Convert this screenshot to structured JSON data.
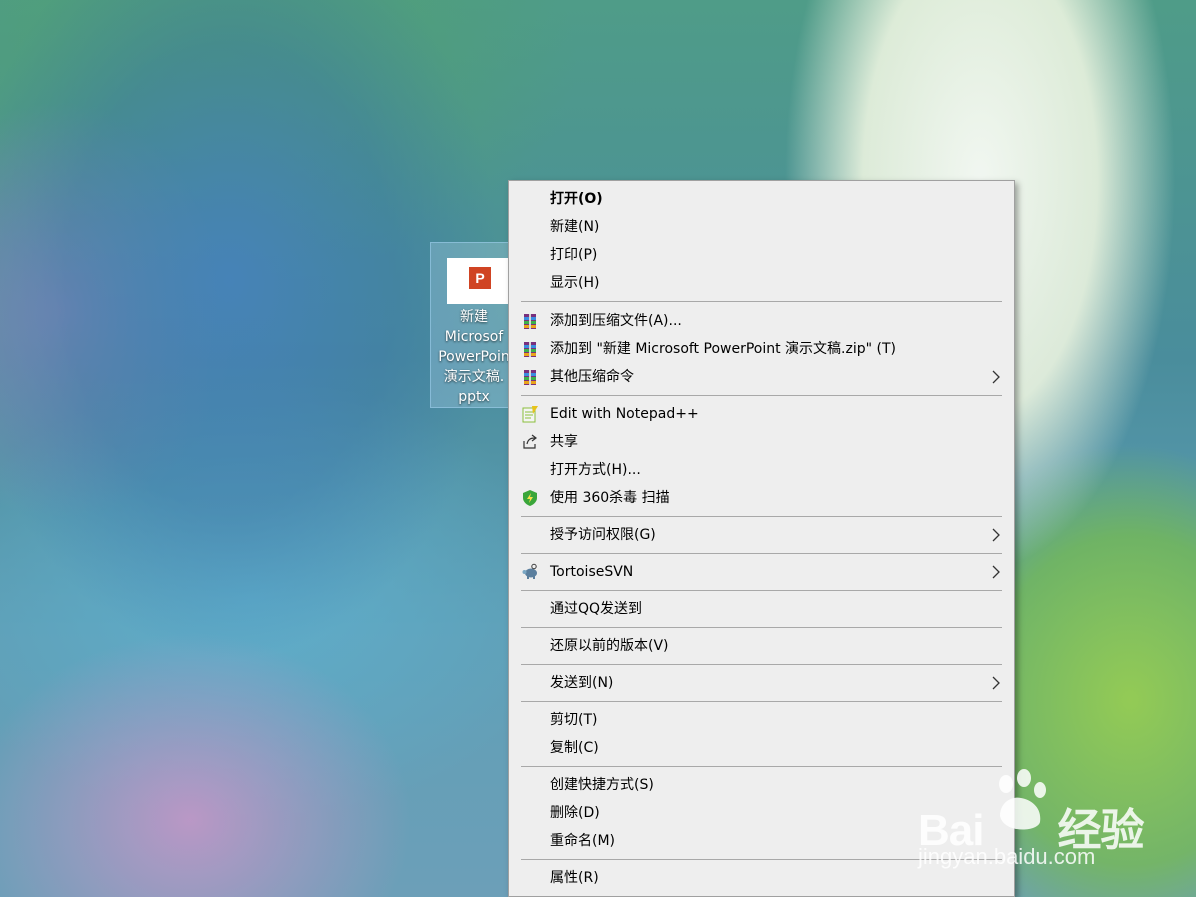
{
  "desktop": {
    "file_icon": {
      "badge": "P",
      "label_lines": [
        "新建",
        "Microsof",
        "PowerPoin",
        "演示文稿.",
        "pptx"
      ]
    }
  },
  "context_menu": {
    "items": {
      "open": "打开(O)",
      "new": "新建(N)",
      "print": "打印(P)",
      "show": "显示(H)",
      "add_archive": "添加到压缩文件(A)...",
      "add_zip": "添加到 \"新建 Microsoft PowerPoint 演示文稿.zip\" (T)",
      "other_compress": "其他压缩命令",
      "notepadpp": "Edit with Notepad++",
      "share": "共享",
      "open_with": "打开方式(H)...",
      "scan_360": "使用 360杀毒 扫描",
      "grant_access": "授予访问权限(G)",
      "tortoisesvn": "TortoiseSVN",
      "send_qq": "通过QQ发送到",
      "restore_versions": "还原以前的版本(V)",
      "send_to": "发送到(N)",
      "cut": "剪切(T)",
      "copy": "复制(C)",
      "create_shortcut": "创建快捷方式(S)",
      "delete": "删除(D)",
      "rename": "重命名(M)",
      "properties": "属性(R)"
    },
    "icons": {
      "winrar": "winrar-icon",
      "notepadpp": "notepadpp-icon",
      "share": "share-icon",
      "shield360": "shield-360-icon",
      "tortoisesvn": "tortoisesvn-icon",
      "submenu": "chevron-right-icon"
    }
  },
  "watermark": {
    "brand_latin": "Bai",
    "brand_cn": "经验",
    "url": "jingyan.baidu.com"
  }
}
